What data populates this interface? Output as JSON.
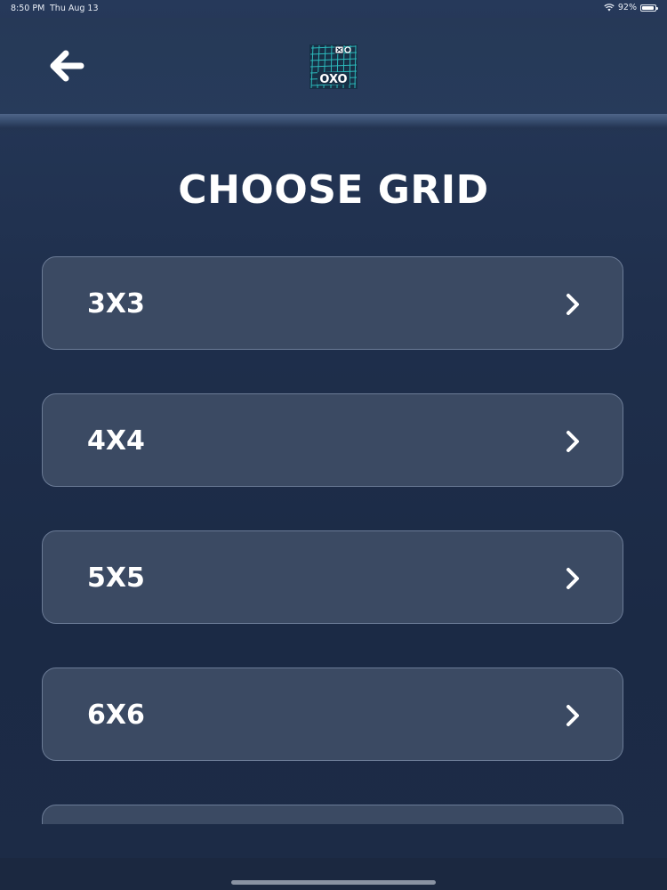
{
  "status_bar": {
    "time": "8:50 PM",
    "date": "Thu Aug 13",
    "battery_text": "92%",
    "battery_level": 0.92
  },
  "header": {
    "back_icon": "arrow-left-icon",
    "logo_text": "OXO"
  },
  "title": "CHOOSE GRID",
  "grid_options": [
    {
      "label": "3X3"
    },
    {
      "label": "4X4"
    },
    {
      "label": "5X5"
    },
    {
      "label": "6X6"
    },
    {
      "label": ""
    }
  ],
  "colors": {
    "background": "#1f2e48",
    "card": "#3b4a63",
    "card_border": "#6b7b96",
    "logo_accent": "#2fc9c9"
  }
}
